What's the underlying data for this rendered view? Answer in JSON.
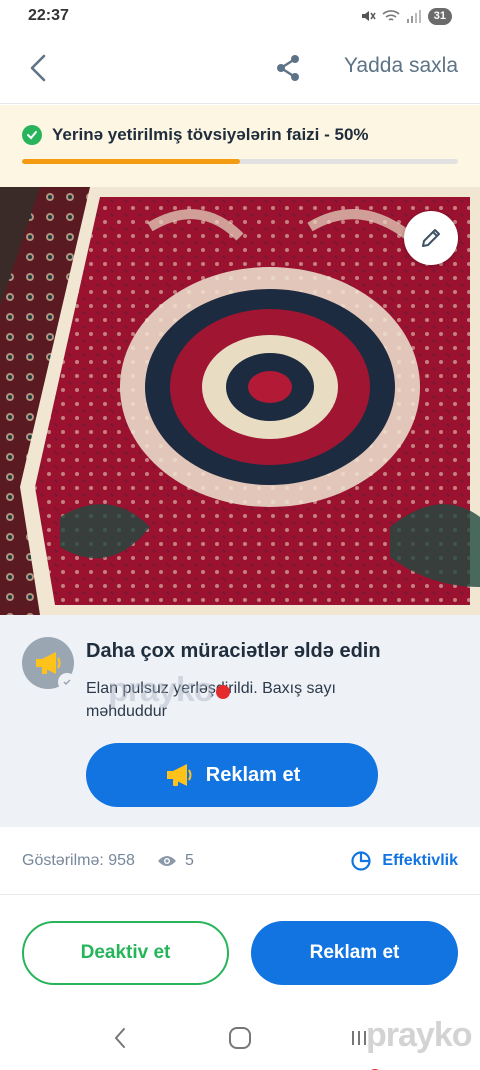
{
  "status_bar": {
    "time": "22:37",
    "battery": "31"
  },
  "header": {
    "save_label": "Yadda saxla"
  },
  "progress": {
    "text": "Yerinə yetirilmiş tövsiyələrin faizi - 50%",
    "fraction": 0.5
  },
  "promo": {
    "title": "Daha çox müraciətlər əldə edin",
    "description": "Elan pulsuz yerləşdirildi. Baxış sayı məhduddur",
    "button_label": "Reklam et"
  },
  "stats": {
    "impressions_label": "Göstərilmə: 958",
    "views": "5",
    "effectiveness_label": "Effektivlik"
  },
  "actions": {
    "deactivate_label": "Deaktiv et",
    "advertise_label": "Reklam et"
  },
  "watermark": "prayko",
  "colors": {
    "accent": "#1274e0",
    "success": "#27b45a",
    "progress": "#f39c12",
    "banner_bg": "#fdf6e2"
  },
  "icons": [
    "back-icon",
    "share-icon",
    "pencil-icon",
    "megaphone-icon",
    "eye-icon",
    "pie-chart-icon",
    "check-icon"
  ]
}
